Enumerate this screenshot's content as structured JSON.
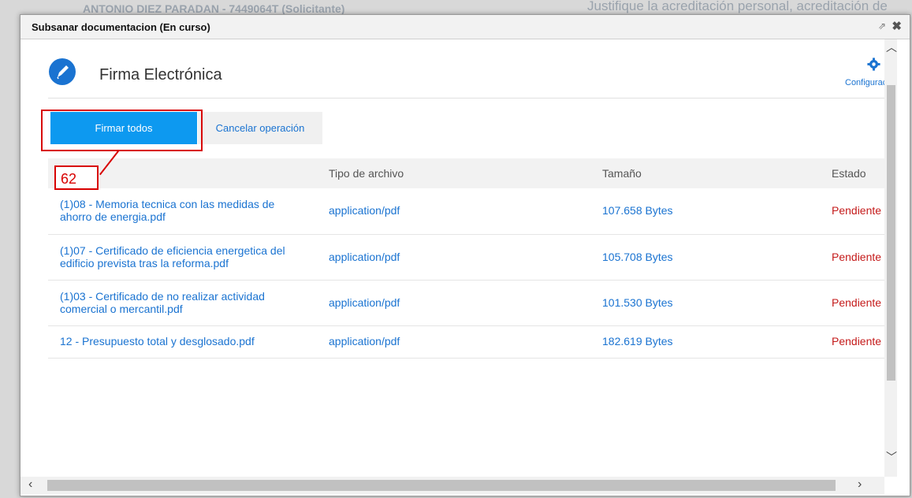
{
  "background": {
    "left_text": "ANTONIO DIEZ PARADAN - 7449064T (Solicitante)",
    "right_text": "Justifique la acreditación personal, acreditación de"
  },
  "dialog": {
    "title": "Subsanar documentacion (En curso)",
    "header_title": "Firma Electrónica",
    "config_label": "Configuración",
    "icons": [
      "external-link-icon",
      "close-icon",
      "pen-icon",
      "gear-icon"
    ]
  },
  "buttons": {
    "sign_all": "Firmar todos",
    "cancel": "Cancelar operación"
  },
  "annotation": {
    "number": "62"
  },
  "table": {
    "headers": [
      "",
      "Tipo de archivo",
      "Tamaño",
      "Estado"
    ],
    "rows": [
      {
        "name": "(1)08 - Memoria tecnica con las medidas de ahorro de energia.pdf",
        "type": "application/pdf",
        "size": "107.658 Bytes",
        "status": "Pendiente"
      },
      {
        "name": "(1)07 - Certificado de eficiencia energetica del edificio prevista tras la reforma.pdf",
        "type": "application/pdf",
        "size": "105.708 Bytes",
        "status": "Pendiente"
      },
      {
        "name": "(1)03 - Certificado de no realizar actividad comercial o mercantil.pdf",
        "type": "application/pdf",
        "size": "101.530 Bytes",
        "status": "Pendiente"
      },
      {
        "name": "12 - Presupuesto total y desglosado.pdf",
        "type": "application/pdf",
        "size": "182.619 Bytes",
        "status": "Pendiente"
      }
    ]
  },
  "colors": {
    "accent": "#0d99f0",
    "link": "#1a73d1",
    "status_pending": "#c41a1a",
    "annotation": "#d80000"
  }
}
